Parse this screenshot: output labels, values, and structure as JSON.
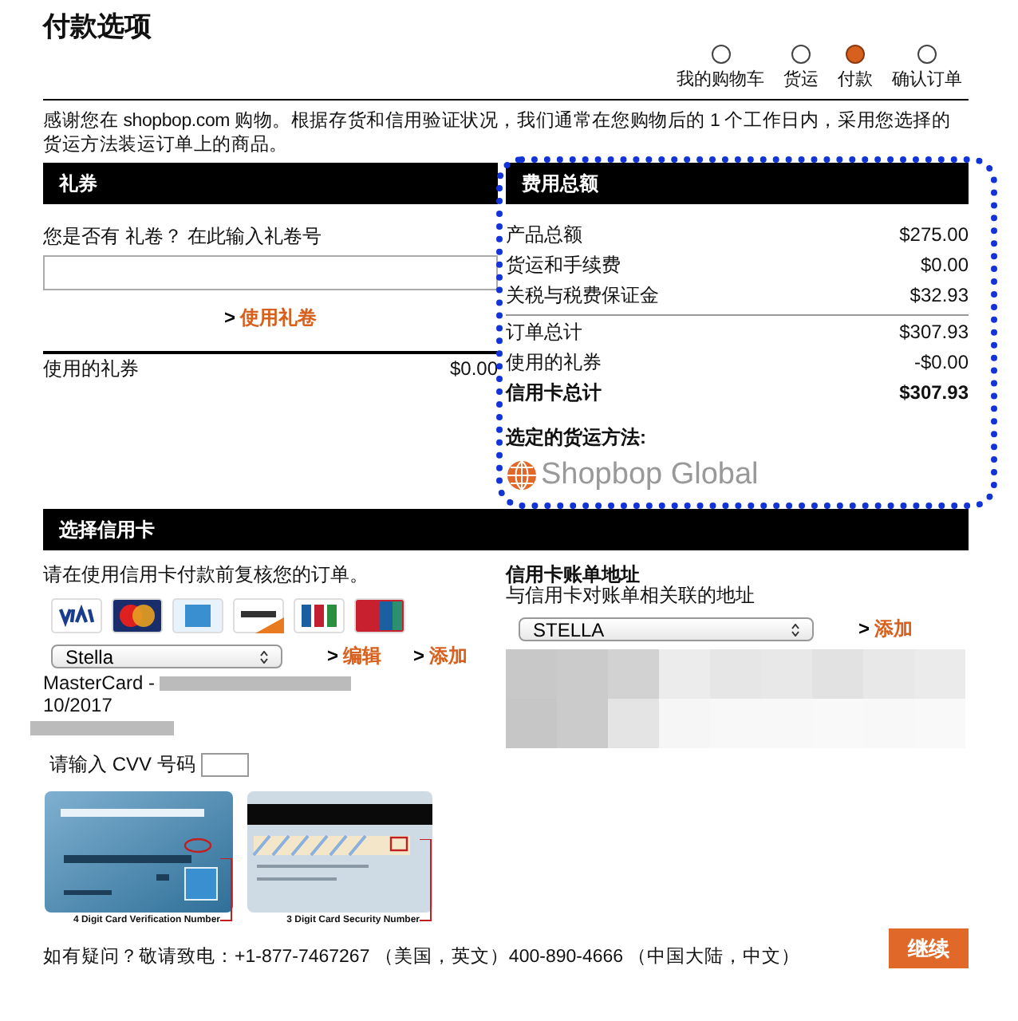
{
  "page_title": "付款选项",
  "steps": [
    {
      "label": "我的购物车",
      "selected": false
    },
    {
      "label": "货运",
      "selected": false
    },
    {
      "label": "付款",
      "selected": true
    },
    {
      "label": "确认订单",
      "selected": false
    }
  ],
  "intro": "感谢您在 shopbop.com 购物。根据存货和信用验证状况，我们通常在您购物后的 1 个工作日内，采用您选择的货运方法装运订单上的商品。",
  "gift_card": {
    "header": "礼券",
    "prompt": "您是否有 礼卷？ 在此输入礼卷号",
    "link": {
      "arrow": ">",
      "label": "使用礼卷"
    },
    "applied_label": "使用的礼券",
    "applied_value": "$0.00"
  },
  "summary": {
    "header": "费用总额",
    "rows": [
      {
        "label": "产品总额",
        "value": "$275.00",
        "bold": false,
        "divider": false
      },
      {
        "label": "货运和手续费",
        "value": "$0.00",
        "bold": false,
        "divider": false
      },
      {
        "label": "关税与税费保证金",
        "value": "$32.93",
        "bold": false,
        "divider": false
      },
      {
        "label": "订单总计",
        "value": "$307.93",
        "bold": false,
        "divider": true
      },
      {
        "label": "使用的礼券",
        "value": "-$0.00",
        "bold": false,
        "divider": false
      },
      {
        "label": "信用卡总计",
        "value": "$307.93",
        "bold": true,
        "divider": false
      }
    ],
    "shipping_label": "选定的货运方法:",
    "shipping_method": "Shopbop Global"
  },
  "card": {
    "header": "选择信用卡",
    "note": "请在使用信用卡付款前复核您的订单。",
    "selected_card": "Stella",
    "links": [
      {
        "arrow": ">",
        "label": "编辑"
      },
      {
        "arrow": ">",
        "label": "添加"
      }
    ],
    "card_line": "MasterCard -",
    "expiry": "10/2017",
    "cvv_label": "请输入 CVV 号码",
    "captions": [
      "4 Digit Card Verification Number",
      "3 Digit Card Security Number"
    ]
  },
  "billing": {
    "title": "信用卡账单地址",
    "subtitle": "与信用卡对账单相关联的地址",
    "selected_address": "STELLA",
    "link": {
      "arrow": ">",
      "label": "添加"
    }
  },
  "footer": {
    "help": "如有疑问？敬请致电：+1-877-7467267 （美国，英文）400-890-4666 （中国大陆，中文）",
    "continue": "继续"
  }
}
